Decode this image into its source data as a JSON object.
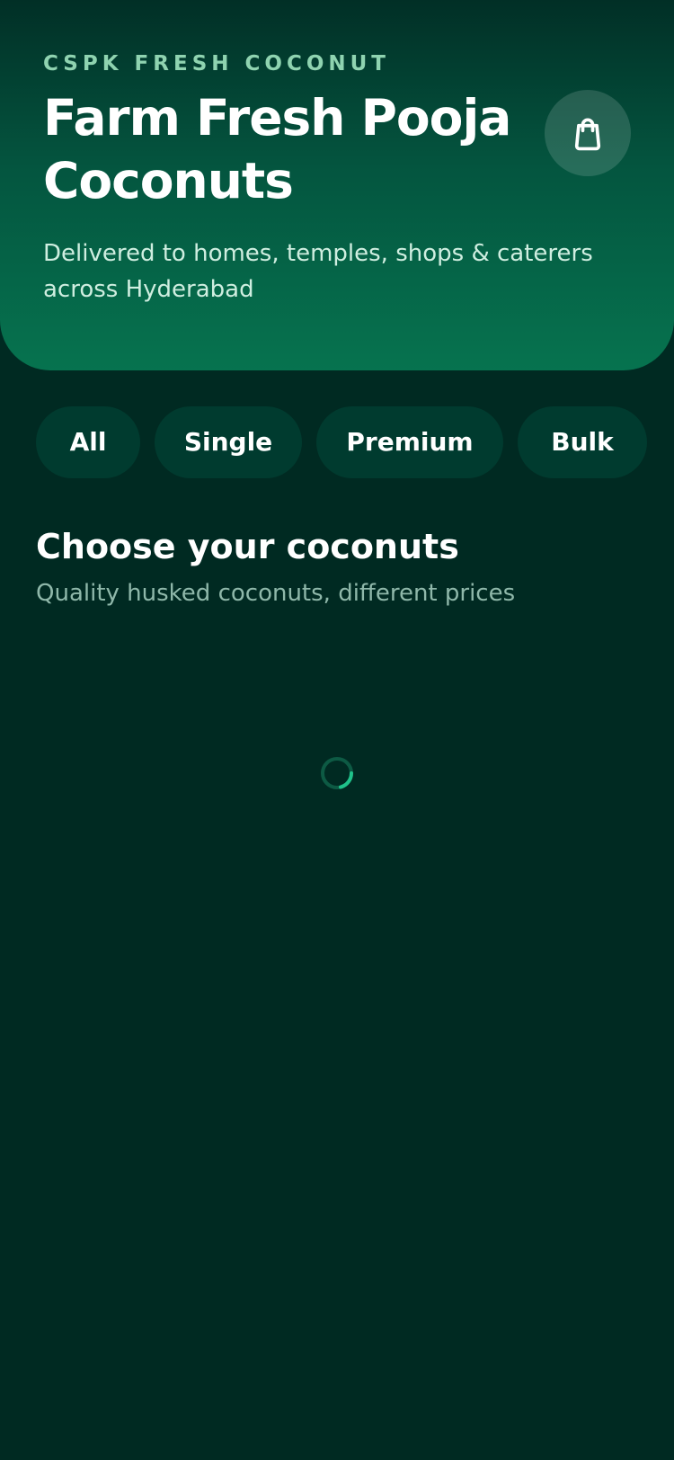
{
  "header": {
    "eyebrow": "CSPK FRESH COCONUT",
    "title": "Farm Fresh Pooja Coconuts",
    "subtitle": "Delivered to homes, temples, shops & caterers across Hyderabad",
    "cart_icon": "shopping-bag-icon"
  },
  "filters": {
    "chips": [
      {
        "label": "All"
      },
      {
        "label": "Single"
      },
      {
        "label": "Premium"
      },
      {
        "label": "Bulk"
      }
    ]
  },
  "section": {
    "title": "Choose your coconuts",
    "subtitle": "Quality husked coconuts, different prices"
  },
  "loading": {
    "icon": "loading-spinner-icon"
  },
  "colors": {
    "background": "#002a22",
    "hero_top": "#012f26",
    "hero_bottom": "#06734f",
    "chip_background": "#003b2f",
    "accent": "#1fc28a",
    "eyebrow": "#8fd3b0",
    "muted_text": "#8fb8aa"
  }
}
